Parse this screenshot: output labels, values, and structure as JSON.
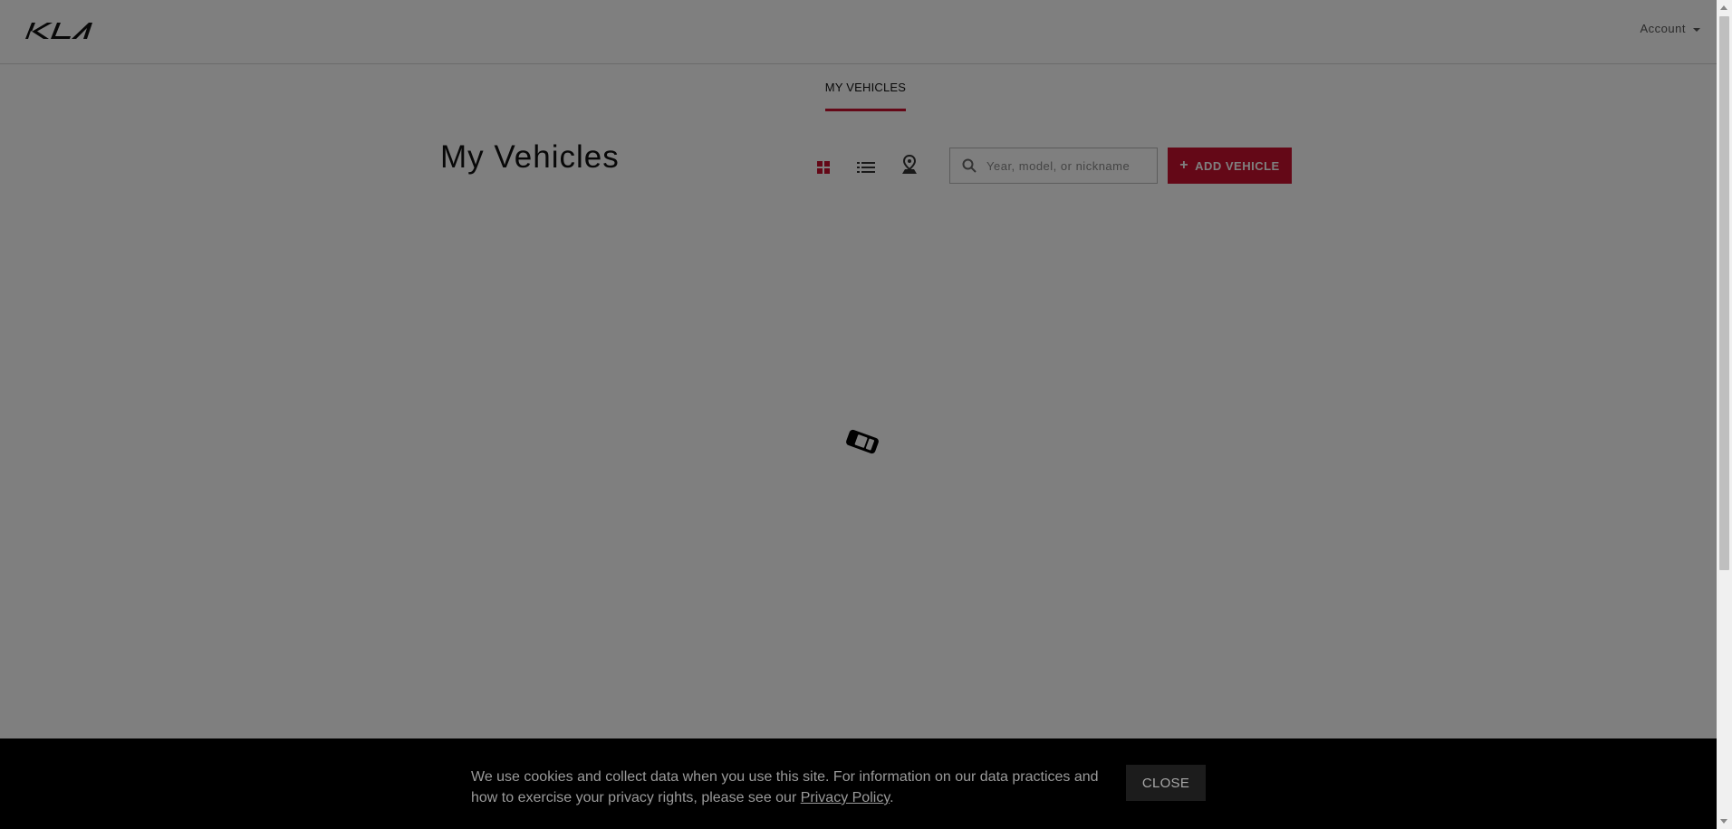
{
  "header": {
    "logo_alt": "KIA",
    "account_label": "Account"
  },
  "subnav": {
    "tabs": [
      {
        "label": "MY VEHICLES",
        "active": true
      }
    ]
  },
  "main": {
    "title": "My Vehicles",
    "views": [
      {
        "name": "grid",
        "icon": "grid-icon",
        "active": true
      },
      {
        "name": "list",
        "icon": "list-icon",
        "active": false
      },
      {
        "name": "map",
        "icon": "map-pin-icon",
        "active": false
      }
    ],
    "search": {
      "placeholder": "Year, model, or nickname",
      "value": ""
    },
    "add_button_label": "ADD VEHICLE",
    "loading": true
  },
  "cookie_banner": {
    "text_before_link": "We use cookies and collect data when you use this site. For information on our data practices and how to exercise your privacy rights, please see our ",
    "link_label": "Privacy Policy",
    "text_after_link": ".",
    "close_label": "CLOSE"
  },
  "colors": {
    "brand_red": "#c8102e",
    "overlay": "rgba(0,0,0,0.5)",
    "banner": "#000000"
  }
}
